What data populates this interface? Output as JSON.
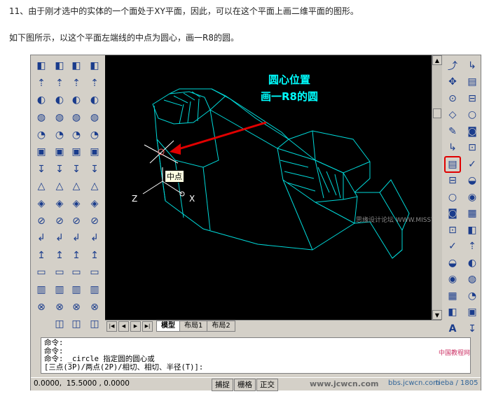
{
  "intro": {
    "line1": "11、由于刚才选中的实体的一个面处于XY平面，因此，可以在这个平面上画二维平面的图形。",
    "line2": "如下图所示，以这个平面左端线的中点为圆心，画一R8的圆。"
  },
  "left_toolbar": {
    "col1_icons": [
      "ucs-icon",
      "ucs-world-icon",
      "ucs-previous-icon",
      "ucs-face-icon",
      "ucs-object-icon",
      "ucs-view-icon",
      "ucs-origin-icon",
      "ucs-zaxis-icon",
      "ucs-3point-icon",
      "ucs-x-icon",
      "ucs-y-icon",
      "ucs-z-icon",
      "ucs-apply-icon",
      "ucs-named-icon",
      "ucs-move-icon"
    ],
    "col2_icons": [
      "box-icon",
      "sphere-icon",
      "cylinder-icon",
      "cone-icon",
      "wedge-icon",
      "torus-icon",
      "extrude-icon",
      "revolve-icon",
      "slice-icon",
      "section-icon",
      "interfere-icon",
      "setup-drawing-icon",
      "setup-view-icon",
      "setup-profile-icon",
      "render-icon",
      "light-icon"
    ],
    "col3_icons": [
      "union-icon",
      "subtract-icon",
      "intersect-icon",
      "extrude-face-icon",
      "move-face-icon",
      "offset-face-icon",
      "delete-face-icon",
      "rotate-face-icon",
      "taper-face-icon",
      "copy-face-icon",
      "color-face-icon",
      "copy-edge-icon",
      "color-edge-icon",
      "imprint-icon",
      "clean-icon",
      "separate-icon",
      "shell-icon",
      "check-icon"
    ],
    "col4_icons": [
      "box3d-icon",
      "sphere3d-icon",
      "cylinder3d-icon",
      "cone3d-icon",
      "wedge3d-icon",
      "torus3d-icon",
      "extrude3d-icon",
      "revolve3d-icon",
      "slice3d-icon",
      "section3d-icon",
      "interfere3d-icon",
      "setup3d-icon",
      "view3d-icon",
      "profile3d-icon",
      "shade3d-icon",
      "render3d-icon"
    ]
  },
  "viewport": {
    "annotation_line1": "圆心位置",
    "annotation_line2": "画一R8的圆",
    "snap_tooltip": "中点",
    "axis_z": "Z",
    "axis_x": "X",
    "watermark": "思缘设计论坛 WWW.MISSVUAN.COM",
    "colors": {
      "background": "#000000",
      "model": "#00e0e0",
      "annotation": "#00ffff",
      "arrow": "#e00000"
    }
  },
  "draw_toolbar": {
    "icons": [
      "line-icon",
      "construction-line-icon",
      "polyline-icon",
      "polygon-icon",
      "rectangle-icon",
      "arc-icon",
      "circle-icon",
      "revcloud-icon",
      "spline-icon",
      "ellipse-icon",
      "ellipse-arc-icon",
      "insert-block-icon",
      "make-block-icon",
      "point-icon",
      "hatch-icon",
      "region-icon",
      "multiline-text-icon"
    ],
    "active": "circle-icon",
    "text_tool_label": "A"
  },
  "modify_toolbar": {
    "icons": [
      "erase-icon",
      "copy-icon",
      "mirror-icon",
      "offset-icon",
      "array-icon",
      "move-icon",
      "rotate-icon",
      "scale-icon",
      "stretch-icon",
      "trim-icon",
      "extend-icon",
      "break-point-icon",
      "break-icon",
      "join-icon",
      "chamfer-icon",
      "fillet-icon",
      "explode-icon"
    ]
  },
  "layout_tabs": [
    "模型",
    "布局1",
    "布局2"
  ],
  "command_lines": [
    "命令:",
    "命令:",
    "命令: _circle 指定圆的圆心或",
    "[三点(3P)/两点(2P)/相切、相切、半径(T)]:"
  ],
  "status_bar": {
    "coordinates": "0.0000,  15.5000 , 0.0000",
    "buttons": [
      "捕捉",
      "栅格",
      "正交"
    ]
  },
  "watermarks": {
    "bottom": "www.jcwcn.com",
    "site": "中国教程网",
    "bbs": "bbs.jcwcn.com",
    "tieba": "tieba / 1805"
  }
}
